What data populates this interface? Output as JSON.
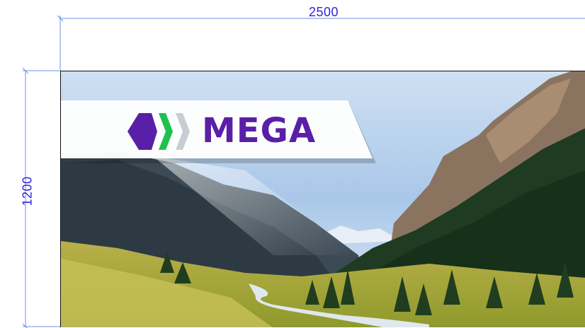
{
  "dimensions": {
    "width_label": "2500",
    "height_label": "1200",
    "line_color": "#2f1fd8"
  },
  "banner": {
    "brand_name": "MEGA",
    "brand_color": "#5a1fa8",
    "accent_green": "#1ec14b",
    "accent_gray": "#c9ccd1",
    "photo_subject": "mountain-valley-photo"
  }
}
